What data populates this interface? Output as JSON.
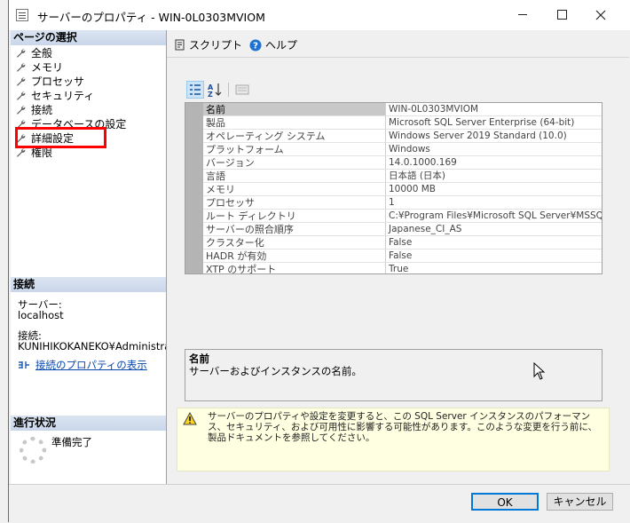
{
  "window": {
    "title": "サーバーのプロパティ - WIN-0L0303MVIOM"
  },
  "left": {
    "page_select_header": "ページの選択",
    "pages": [
      "全般",
      "メモリ",
      "プロセッサ",
      "セキュリティ",
      "接続",
      "データベースの設定",
      "詳細設定",
      "権限"
    ],
    "connection_header": "接続",
    "server_label": "サーバー:",
    "server_value": "localhost",
    "connection_label": "接続:",
    "connection_value": "KUNIHIKOKANEKO¥Administrator",
    "view_properties_link": "接続のプロパティの表示",
    "progress_header": "進行状況",
    "progress_status": "準備完了"
  },
  "toolbar": {
    "script_label": "スクリプト",
    "help_label": "ヘルプ"
  },
  "properties": [
    {
      "name": "名前",
      "value": "WIN-0L0303MVIOM"
    },
    {
      "name": "製品",
      "value": "Microsoft SQL Server Enterprise (64-bit)"
    },
    {
      "name": "オペレーティング システム",
      "value": "Windows Server 2019 Standard (10.0)"
    },
    {
      "name": "プラットフォーム",
      "value": "Windows"
    },
    {
      "name": "バージョン",
      "value": "14.0.1000.169"
    },
    {
      "name": "言語",
      "value": "日本語 (日本)"
    },
    {
      "name": "メモリ",
      "value": "10000 MB"
    },
    {
      "name": "プロセッサ",
      "value": "1"
    },
    {
      "name": "ルート ディレクトリ",
      "value": "C:¥Program Files¥Microsoft SQL Server¥MSSQ"
    },
    {
      "name": "サーバーの照合順序",
      "value": "Japanese_CI_AS"
    },
    {
      "name": "クラスター化",
      "value": "False"
    },
    {
      "name": "HADR が有効",
      "value": "False"
    },
    {
      "name": "XTP のサポート",
      "value": "True"
    }
  ],
  "description": {
    "title": "名前",
    "text": "サーバーおよびインスタンスの名前。"
  },
  "warning": {
    "text": "サーバーのプロパティや設定を変更すると、この SQL Server インスタンスのパフォーマンス、セキュリティ、および可用性に影響する可能性があります。このような変更を行う前に、製品ドキュメントを参照してください。"
  },
  "buttons": {
    "ok": "OK",
    "cancel": "キャンセル"
  },
  "colors": {
    "highlight": "#ff0000",
    "accent": "#0078d7",
    "link": "#0645ad"
  }
}
